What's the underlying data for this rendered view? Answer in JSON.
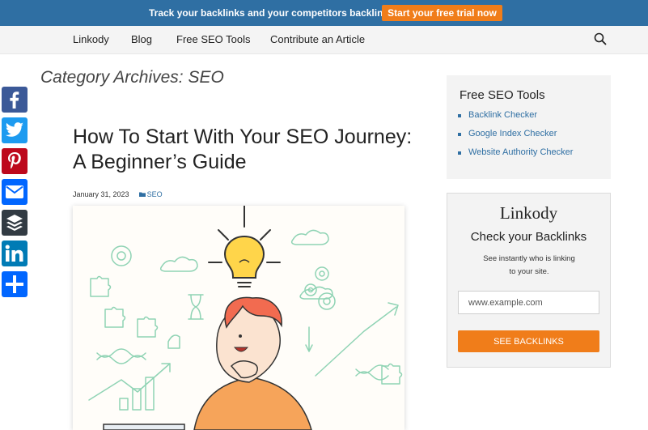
{
  "promo": {
    "text": "Track your backlinks and your competitors backlinks",
    "cta": "Start your free trial now"
  },
  "nav": {
    "items": [
      "Linkody",
      "Blog",
      "Free SEO Tools",
      "Contribute an Article"
    ],
    "search_icon": "search-icon"
  },
  "share": [
    {
      "name": "facebook",
      "icon": "facebook-icon",
      "color": "#3b5998"
    },
    {
      "name": "twitter",
      "icon": "twitter-icon",
      "color": "#1d9bf0"
    },
    {
      "name": "pinterest",
      "icon": "pinterest-icon",
      "color": "#bd081c"
    },
    {
      "name": "email",
      "icon": "email-icon",
      "color": "#0166ff"
    },
    {
      "name": "buffer",
      "icon": "buffer-icon",
      "color": "#323b43"
    },
    {
      "name": "linkedin",
      "icon": "linkedin-icon",
      "color": "#007bb5"
    },
    {
      "name": "share",
      "icon": "plus-share-icon",
      "color": "#0166ff"
    }
  ],
  "page": {
    "category_title": "Category Archives: SEO"
  },
  "post": {
    "title": "How To Start With Your SEO Journey: A Beginner’s Guide",
    "date": "January 31, 2023",
    "category": "SEO"
  },
  "sidebar": {
    "tools_title": "Free SEO Tools",
    "tools": [
      "Backlink Checker",
      "Google Index Checker",
      "Website Authority Checker"
    ],
    "checker": {
      "logo": "Linkody",
      "title": "Check your Backlinks",
      "subtitle": "See instantly who is linking to your site.",
      "placeholder": "www.example.com",
      "button": "SEE BACKLINKS"
    }
  },
  "colors": {
    "promo_bg": "#2f6fa3",
    "accent": "#f07d1a",
    "link": "#2f6fa3",
    "illustration_lines": "#8fd3b4",
    "character_hair": "#f26b50",
    "character_shirt": "#f6a45a"
  }
}
